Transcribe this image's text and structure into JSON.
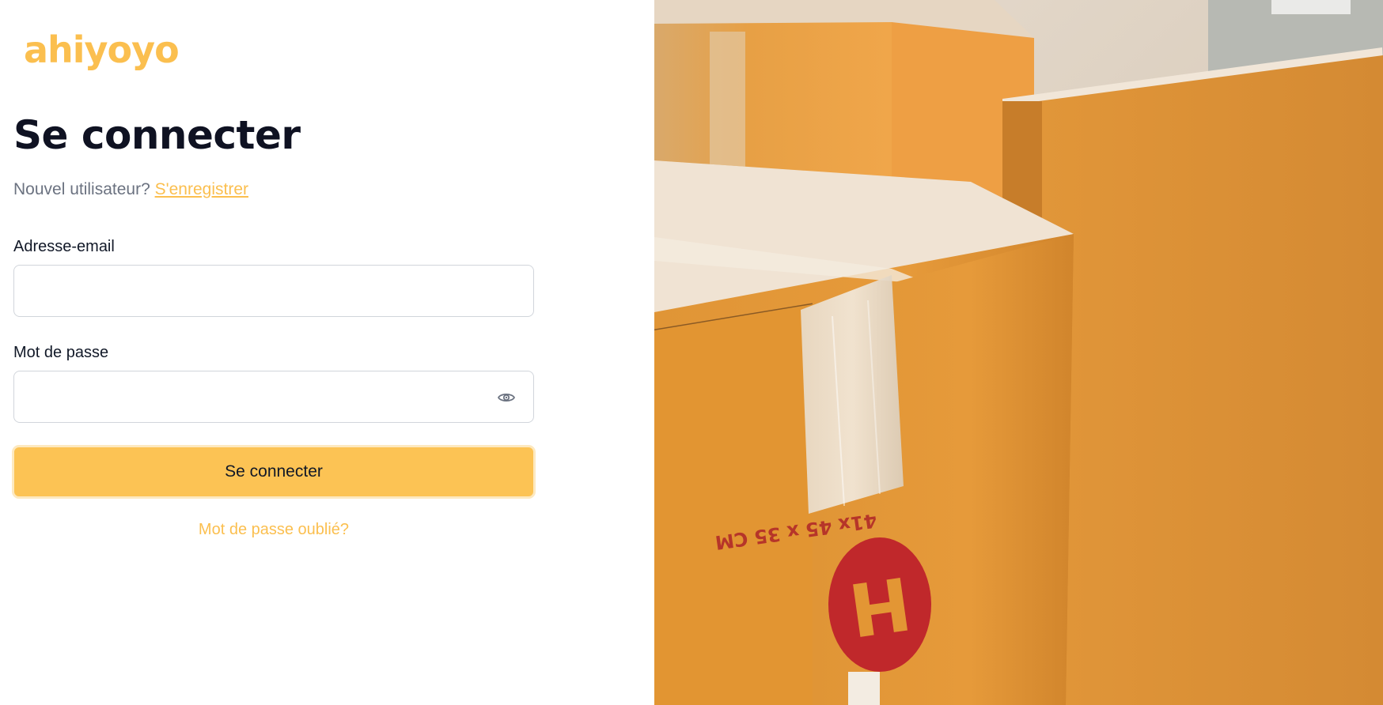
{
  "brand": {
    "logo_text": "ahiyoyo",
    "accent_color": "#fbbf4f"
  },
  "login": {
    "title": "Se connecter",
    "subtitle_prefix": "Nouvel utilisateur? ",
    "register_link": "S'enregistrer",
    "email_label": "Adresse-email",
    "email_value": "",
    "password_label": "Mot de passe",
    "password_value": "",
    "password_toggle_icon": "eye-icon",
    "submit_label": "Se connecter",
    "forgot_link": "Mot de passe oublié?"
  },
  "hero": {
    "box_print": "41x 45 x 35 CM",
    "box_logo_letter": "H"
  },
  "colors": {
    "button_bg": "#fcc354",
    "title_color": "#0f1222",
    "box_orange": "#e39634",
    "stamp_red": "#c0282b"
  }
}
